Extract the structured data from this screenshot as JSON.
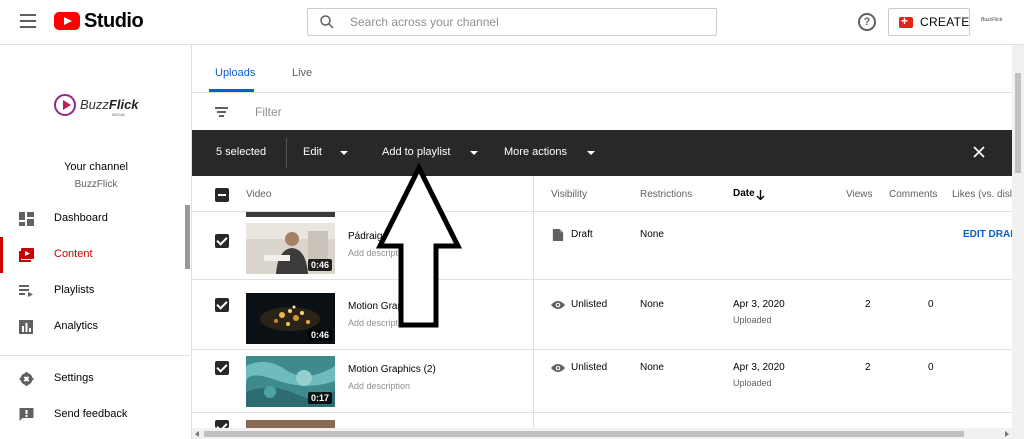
{
  "header": {
    "logo_text": "Studio",
    "search_placeholder": "Search across your channel",
    "help_icon": "?",
    "create_label": "CREATE",
    "account_label": "BuzzFlick"
  },
  "sidebar": {
    "brand_name_light": "Buzz",
    "brand_name_bold": "Flick",
    "brand_sub": "MEDIA",
    "your_channel": "Your channel",
    "channel_name": "BuzzFlick",
    "items": [
      {
        "label": "Dashboard",
        "icon": "dashboard-icon"
      },
      {
        "label": "Content",
        "icon": "content-icon",
        "active": true
      },
      {
        "label": "Playlists",
        "icon": "playlists-icon"
      },
      {
        "label": "Analytics",
        "icon": "analytics-icon"
      },
      {
        "label": "Settings",
        "icon": "gear-icon"
      },
      {
        "label": "Send feedback",
        "icon": "feedback-icon"
      }
    ]
  },
  "tabs": [
    {
      "label": "Uploads",
      "active": true
    },
    {
      "label": "Live"
    }
  ],
  "filter": {
    "placeholder": "Filter"
  },
  "action_bar": {
    "selected": "5 selected",
    "edit": "Edit",
    "add_to_playlist": "Add to playlist",
    "more_actions": "More actions"
  },
  "table": {
    "columns": [
      "Video",
      "Visibility",
      "Restrictions",
      "Date",
      "Views",
      "Comments",
      "Likes (vs. disli"
    ],
    "rows": [
      {
        "title": "Pádraig Coffey 1",
        "description": "Add description",
        "duration": "0:46",
        "visibility": "Draft",
        "visibility_icon": "draft-icon",
        "restrictions": "None",
        "date": "",
        "date_sub": "",
        "views": "",
        "comments": "",
        "action": "EDIT DRAFT"
      },
      {
        "title": "Motion Graphics (3)",
        "description": "Add description",
        "duration": "0:46",
        "visibility": "Unlisted",
        "visibility_icon": "eye-icon",
        "restrictions": "None",
        "date": "Apr 3, 2020",
        "date_sub": "Uploaded",
        "views": "2",
        "comments": "0",
        "action": ""
      },
      {
        "title": "Motion Graphics (2)",
        "description": "Add description",
        "duration": "0:17",
        "visibility": "Unlisted",
        "visibility_icon": "eye-icon",
        "restrictions": "None",
        "date": "Apr 3, 2020",
        "date_sub": "Uploaded",
        "views": "2",
        "comments": "0",
        "action": ""
      }
    ]
  },
  "colors": {
    "youtube_red": "#ff0000",
    "link_blue": "#065fd4",
    "action_bar_bg": "#282828",
    "active_nav": "#cc0000"
  }
}
